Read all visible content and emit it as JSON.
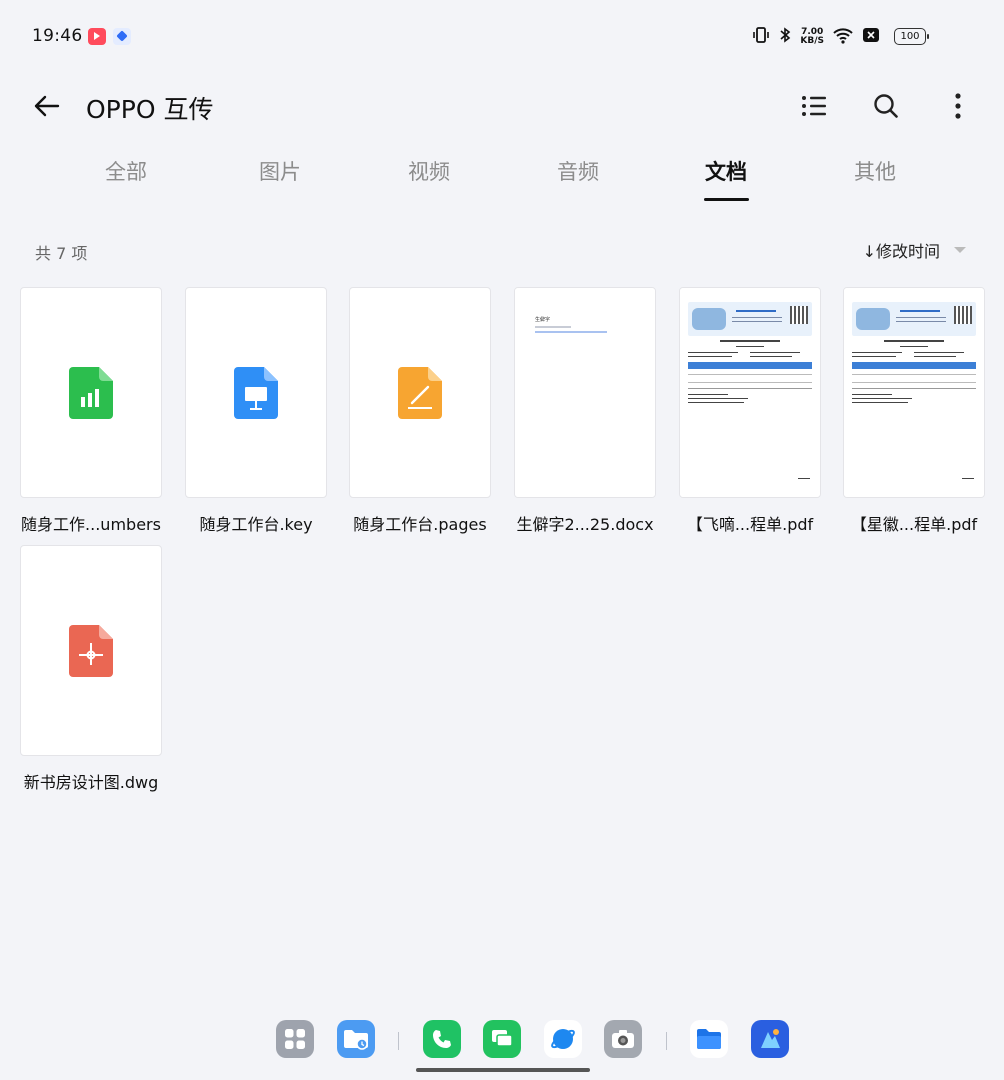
{
  "status_bar": {
    "time": "19:46",
    "net_speed_value": "7.00",
    "net_speed_unit": "KB/S",
    "battery": "100",
    "icons": [
      "app-notification-icon",
      "layers-app-icon",
      "vibrate-icon",
      "bluetooth-icon",
      "wifi-icon",
      "sim-off-icon",
      "battery-icon"
    ]
  },
  "header": {
    "title": "OPPO 互传",
    "icons": [
      "back-arrow-icon",
      "list-view-icon",
      "search-icon",
      "more-vertical-icon"
    ]
  },
  "tabs": [
    {
      "label": "全部",
      "active": false
    },
    {
      "label": "图片",
      "active": false
    },
    {
      "label": "视频",
      "active": false
    },
    {
      "label": "音频",
      "active": false
    },
    {
      "label": "文档",
      "active": true
    },
    {
      "label": "其他",
      "active": false
    }
  ],
  "list_info": {
    "count_text": "共 7 项",
    "sort_label": "↓修改时间"
  },
  "files": [
    {
      "name": "随身工作...umbers",
      "icon": "numbers-file-icon",
      "color": "#2cbe4e"
    },
    {
      "name": "随身工作台.key",
      "icon": "keynote-file-icon",
      "color": "#2f8ff6"
    },
    {
      "name": "随身工作台.pages",
      "icon": "pages-file-icon",
      "color": "#f7a531"
    },
    {
      "name": "生僻字2...25.docx",
      "icon": "docx-thumbnail",
      "doc_heading": "生僻字"
    },
    {
      "name": "【飞嘀...程单.pdf",
      "icon": "pdf-thumbnail"
    },
    {
      "name": "【星徽...程单.pdf",
      "icon": "pdf-thumbnail"
    },
    {
      "name": "新书房设计图.dwg",
      "icon": "dwg-file-icon",
      "color": "#ea6753"
    }
  ],
  "dock": {
    "apps": [
      "app-drawer-icon",
      "file-manager-recent-icon",
      "phone-icon",
      "messages-icon",
      "browser-icon",
      "camera-icon",
      "files-icon",
      "gallery-icon"
    ]
  },
  "colors": {
    "background": "#f3f4f8",
    "accent_green": "#2cbe4e",
    "accent_blue": "#2f8ff6",
    "accent_orange": "#f7a531",
    "accent_red": "#ea6753"
  }
}
